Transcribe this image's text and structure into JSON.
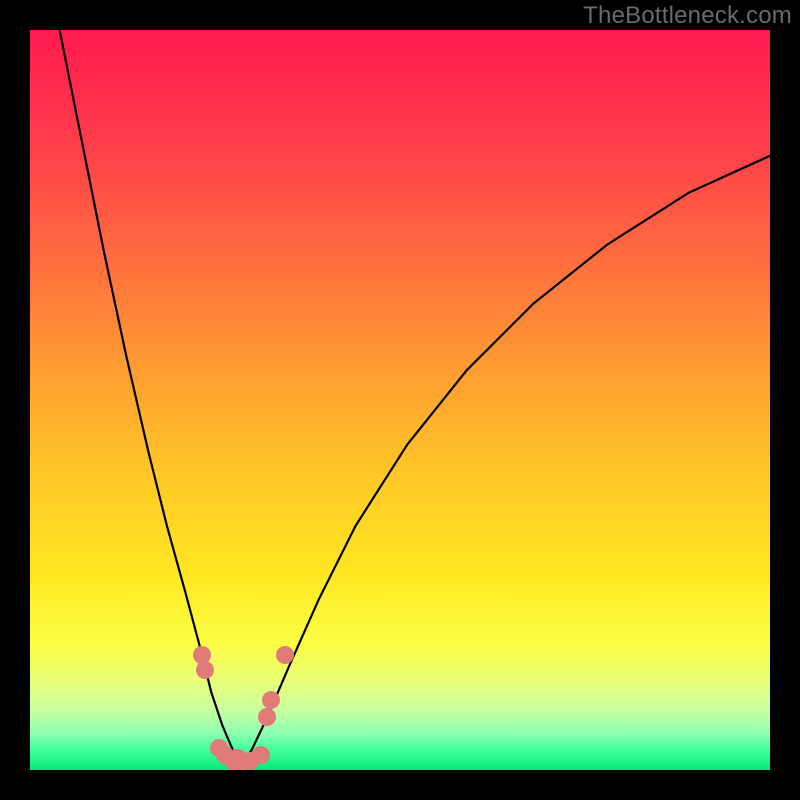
{
  "watermark": "TheBottleneck.com",
  "colors": {
    "frame": "#000000",
    "gradient_stops": [
      {
        "offset": 0.0,
        "color": "#ff1a4e"
      },
      {
        "offset": 0.15,
        "color": "#ff3c4b"
      },
      {
        "offset": 0.3,
        "color": "#ff6a3f"
      },
      {
        "offset": 0.45,
        "color": "#ff9a32"
      },
      {
        "offset": 0.6,
        "color": "#ffc727"
      },
      {
        "offset": 0.74,
        "color": "#ffe822"
      },
      {
        "offset": 0.83,
        "color": "#fbff45"
      },
      {
        "offset": 0.88,
        "color": "#eaff78"
      },
      {
        "offset": 0.92,
        "color": "#c7ffa0"
      },
      {
        "offset": 0.95,
        "color": "#8cffb3"
      },
      {
        "offset": 0.975,
        "color": "#3bff9a"
      },
      {
        "offset": 1.0,
        "color": "#07e87a"
      }
    ],
    "curve": "#000000",
    "marker_fill": "#e07b78"
  },
  "chart_data": {
    "type": "line",
    "title": "",
    "xlabel": "",
    "ylabel": "",
    "xlim": [
      0,
      1
    ],
    "ylim": [
      0,
      1
    ],
    "minimum_x": 0.28,
    "series": [
      {
        "name": "left_branch",
        "x": [
          0.04,
          0.07,
          0.1,
          0.13,
          0.16,
          0.185,
          0.21,
          0.23,
          0.245,
          0.26,
          0.275,
          0.285
        ],
        "y": [
          1.0,
          0.85,
          0.7,
          0.56,
          0.43,
          0.33,
          0.24,
          0.165,
          0.105,
          0.06,
          0.025,
          0.005
        ]
      },
      {
        "name": "right_branch",
        "x": [
          0.285,
          0.3,
          0.32,
          0.35,
          0.39,
          0.44,
          0.51,
          0.59,
          0.68,
          0.78,
          0.89,
          1.0
        ],
        "y": [
          0.005,
          0.028,
          0.07,
          0.14,
          0.23,
          0.33,
          0.44,
          0.54,
          0.63,
          0.71,
          0.78,
          0.83
        ]
      }
    ],
    "markers": [
      {
        "x": 0.233,
        "y": 0.155,
        "r": 9
      },
      {
        "x": 0.237,
        "y": 0.135,
        "r": 9
      },
      {
        "x": 0.255,
        "y": 0.03,
        "r": 9
      },
      {
        "x": 0.263,
        "y": 0.02,
        "r": 9
      },
      {
        "x": 0.28,
        "y": 0.012,
        "r": 12
      },
      {
        "x": 0.297,
        "y": 0.012,
        "r": 9
      },
      {
        "x": 0.312,
        "y": 0.02,
        "r": 9
      },
      {
        "x": 0.32,
        "y": 0.072,
        "r": 9
      },
      {
        "x": 0.325,
        "y": 0.095,
        "r": 9
      },
      {
        "x": 0.345,
        "y": 0.155,
        "r": 9
      }
    ]
  }
}
